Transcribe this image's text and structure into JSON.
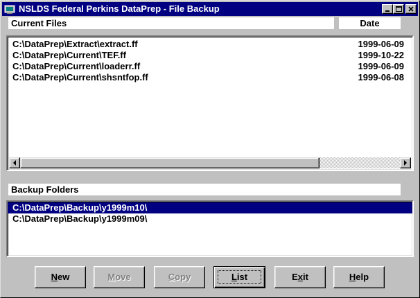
{
  "window": {
    "title": "NSLDS Federal Perkins DataPrep - File Backup",
    "title_bar_color": "#000080"
  },
  "current_files": {
    "header_label": "Current Files",
    "date_header_label": "Date",
    "rows": [
      {
        "path": "C:\\DataPrep\\Extract\\extract.ff",
        "date": "1999-06-09"
      },
      {
        "path": "C:\\DataPrep\\Current\\TEF.ff",
        "date": "1999-10-22"
      },
      {
        "path": "C:\\DataPrep\\Current\\loaderr.ff",
        "date": "1999-06-09"
      },
      {
        "path": "C:\\DataPrep\\Current\\shsntfop.ff",
        "date": "1999-06-08"
      }
    ]
  },
  "backup_folders": {
    "header_label": "Backup Folders",
    "items": [
      {
        "path": "C:\\DataPrep\\Backup\\y1999m10\\",
        "selected": true
      },
      {
        "path": "C:\\DataPrep\\Backup\\y1999m09\\",
        "selected": false
      }
    ],
    "selection_color": "#000080"
  },
  "buttons": {
    "new": {
      "first": "N",
      "rest": "ew",
      "enabled": true
    },
    "move": {
      "first": "M",
      "rest": "ove",
      "enabled": false
    },
    "copy": {
      "first": "C",
      "rest": "opy",
      "enabled": false
    },
    "list": {
      "first": "L",
      "rest": "ist",
      "enabled": true,
      "focused": true
    },
    "exit": {
      "pre": "E",
      "under": "x",
      "post": "it",
      "enabled": true
    },
    "help": {
      "first": "H",
      "rest": "elp",
      "enabled": true
    }
  }
}
